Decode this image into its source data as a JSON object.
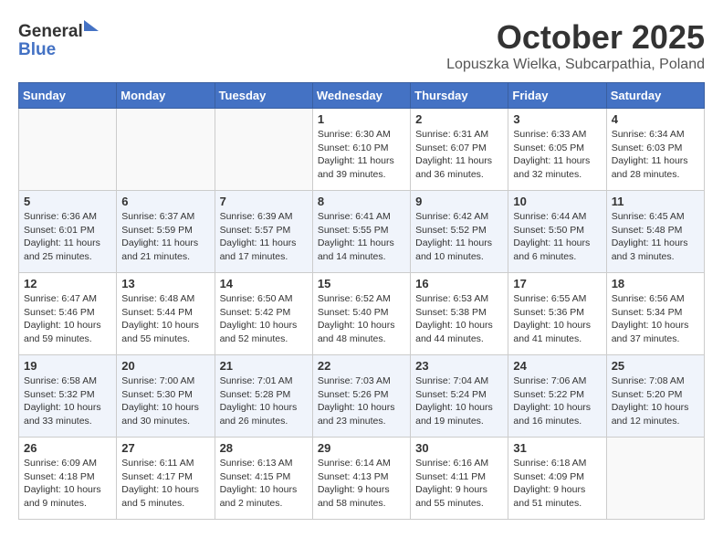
{
  "header": {
    "logo_general": "General",
    "logo_blue": "Blue",
    "month_title": "October 2025",
    "location": "Lopuszka Wielka, Subcarpathia, Poland"
  },
  "days_of_week": [
    "Sunday",
    "Monday",
    "Tuesday",
    "Wednesday",
    "Thursday",
    "Friday",
    "Saturday"
  ],
  "weeks": [
    [
      {
        "date": "",
        "info": ""
      },
      {
        "date": "",
        "info": ""
      },
      {
        "date": "",
        "info": ""
      },
      {
        "date": "1",
        "info": "Sunrise: 6:30 AM\nSunset: 6:10 PM\nDaylight: 11 hours\nand 39 minutes."
      },
      {
        "date": "2",
        "info": "Sunrise: 6:31 AM\nSunset: 6:07 PM\nDaylight: 11 hours\nand 36 minutes."
      },
      {
        "date": "3",
        "info": "Sunrise: 6:33 AM\nSunset: 6:05 PM\nDaylight: 11 hours\nand 32 minutes."
      },
      {
        "date": "4",
        "info": "Sunrise: 6:34 AM\nSunset: 6:03 PM\nDaylight: 11 hours\nand 28 minutes."
      }
    ],
    [
      {
        "date": "5",
        "info": "Sunrise: 6:36 AM\nSunset: 6:01 PM\nDaylight: 11 hours\nand 25 minutes."
      },
      {
        "date": "6",
        "info": "Sunrise: 6:37 AM\nSunset: 5:59 PM\nDaylight: 11 hours\nand 21 minutes."
      },
      {
        "date": "7",
        "info": "Sunrise: 6:39 AM\nSunset: 5:57 PM\nDaylight: 11 hours\nand 17 minutes."
      },
      {
        "date": "8",
        "info": "Sunrise: 6:41 AM\nSunset: 5:55 PM\nDaylight: 11 hours\nand 14 minutes."
      },
      {
        "date": "9",
        "info": "Sunrise: 6:42 AM\nSunset: 5:52 PM\nDaylight: 11 hours\nand 10 minutes."
      },
      {
        "date": "10",
        "info": "Sunrise: 6:44 AM\nSunset: 5:50 PM\nDaylight: 11 hours\nand 6 minutes."
      },
      {
        "date": "11",
        "info": "Sunrise: 6:45 AM\nSunset: 5:48 PM\nDaylight: 11 hours\nand 3 minutes."
      }
    ],
    [
      {
        "date": "12",
        "info": "Sunrise: 6:47 AM\nSunset: 5:46 PM\nDaylight: 10 hours\nand 59 minutes."
      },
      {
        "date": "13",
        "info": "Sunrise: 6:48 AM\nSunset: 5:44 PM\nDaylight: 10 hours\nand 55 minutes."
      },
      {
        "date": "14",
        "info": "Sunrise: 6:50 AM\nSunset: 5:42 PM\nDaylight: 10 hours\nand 52 minutes."
      },
      {
        "date": "15",
        "info": "Sunrise: 6:52 AM\nSunset: 5:40 PM\nDaylight: 10 hours\nand 48 minutes."
      },
      {
        "date": "16",
        "info": "Sunrise: 6:53 AM\nSunset: 5:38 PM\nDaylight: 10 hours\nand 44 minutes."
      },
      {
        "date": "17",
        "info": "Sunrise: 6:55 AM\nSunset: 5:36 PM\nDaylight: 10 hours\nand 41 minutes."
      },
      {
        "date": "18",
        "info": "Sunrise: 6:56 AM\nSunset: 5:34 PM\nDaylight: 10 hours\nand 37 minutes."
      }
    ],
    [
      {
        "date": "19",
        "info": "Sunrise: 6:58 AM\nSunset: 5:32 PM\nDaylight: 10 hours\nand 33 minutes."
      },
      {
        "date": "20",
        "info": "Sunrise: 7:00 AM\nSunset: 5:30 PM\nDaylight: 10 hours\nand 30 minutes."
      },
      {
        "date": "21",
        "info": "Sunrise: 7:01 AM\nSunset: 5:28 PM\nDaylight: 10 hours\nand 26 minutes."
      },
      {
        "date": "22",
        "info": "Sunrise: 7:03 AM\nSunset: 5:26 PM\nDaylight: 10 hours\nand 23 minutes."
      },
      {
        "date": "23",
        "info": "Sunrise: 7:04 AM\nSunset: 5:24 PM\nDaylight: 10 hours\nand 19 minutes."
      },
      {
        "date": "24",
        "info": "Sunrise: 7:06 AM\nSunset: 5:22 PM\nDaylight: 10 hours\nand 16 minutes."
      },
      {
        "date": "25",
        "info": "Sunrise: 7:08 AM\nSunset: 5:20 PM\nDaylight: 10 hours\nand 12 minutes."
      }
    ],
    [
      {
        "date": "26",
        "info": "Sunrise: 6:09 AM\nSunset: 4:18 PM\nDaylight: 10 hours\nand 9 minutes."
      },
      {
        "date": "27",
        "info": "Sunrise: 6:11 AM\nSunset: 4:17 PM\nDaylight: 10 hours\nand 5 minutes."
      },
      {
        "date": "28",
        "info": "Sunrise: 6:13 AM\nSunset: 4:15 PM\nDaylight: 10 hours\nand 2 minutes."
      },
      {
        "date": "29",
        "info": "Sunrise: 6:14 AM\nSunset: 4:13 PM\nDaylight: 9 hours\nand 58 minutes."
      },
      {
        "date": "30",
        "info": "Sunrise: 6:16 AM\nSunset: 4:11 PM\nDaylight: 9 hours\nand 55 minutes."
      },
      {
        "date": "31",
        "info": "Sunrise: 6:18 AM\nSunset: 4:09 PM\nDaylight: 9 hours\nand 51 minutes."
      },
      {
        "date": "",
        "info": ""
      }
    ]
  ]
}
